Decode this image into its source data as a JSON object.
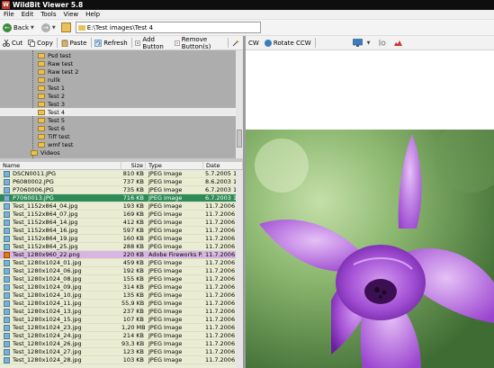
{
  "window": {
    "title": "WildBit Viewer 5.8",
    "app_icon": "W"
  },
  "menu": [
    "File",
    "Edit",
    "Tools",
    "View",
    "Help"
  ],
  "nav": {
    "back_label": "Back",
    "address": "E:\\Test images\\Test 4"
  },
  "toolbar": {
    "cut": "Cut",
    "copy": "Copy",
    "paste": "Paste",
    "refresh": "Refresh",
    "add_button": "Add Button",
    "remove_buttons": "Remove Button(s)"
  },
  "viewer_toolbar": {
    "rotate_cw_partial": "CW",
    "rotate_ccw": "Rotate CCW"
  },
  "tree": {
    "items": [
      {
        "label": "Psd test"
      },
      {
        "label": "Raw test"
      },
      {
        "label": "Raw test 2"
      },
      {
        "label": "rullk"
      },
      {
        "label": "Test 1"
      },
      {
        "label": "Test 2"
      },
      {
        "label": "Test 3"
      },
      {
        "label": "Test 4",
        "selected": true
      },
      {
        "label": "Test 5"
      },
      {
        "label": "Test 6"
      },
      {
        "label": "Tiff test"
      },
      {
        "label": "wmf test"
      },
      {
        "label": "Videos"
      }
    ]
  },
  "list": {
    "columns": [
      "Name",
      "Size",
      "Type",
      "Date modified"
    ],
    "rows": [
      {
        "name": "DSCN0011.JPG",
        "size": "810 KB",
        "type": "JPEG Image",
        "date": "5.7.2005 17:1"
      },
      {
        "name": "P6080002.JPG",
        "size": "737 KB",
        "type": "JPEG Image",
        "date": "8.6.2003 14:5"
      },
      {
        "name": "P7060006.JPG",
        "size": "735 KB",
        "type": "JPEG Image",
        "date": "6.7.2003 14:5"
      },
      {
        "name": "P7060013.JPG",
        "size": "716 KB",
        "type": "JPEG Image",
        "date": "6.7.2003 14:5",
        "selected": true
      },
      {
        "name": "Test_1152x864_04.jpg",
        "size": "193 KB",
        "type": "JPEG Image",
        "date": "11.7.2006 20:"
      },
      {
        "name": "Test_1152x864_07.jpg",
        "size": "169 KB",
        "type": "JPEG Image",
        "date": "11.7.2006 20:"
      },
      {
        "name": "Test_1152x864_14.jpg",
        "size": "412 KB",
        "type": "JPEG Image",
        "date": "11.7.2006 20:"
      },
      {
        "name": "Test_1152x864_16.jpg",
        "size": "597 KB",
        "type": "JPEG Image",
        "date": "11.7.2006 20:"
      },
      {
        "name": "Test_1152x864_19.jpg",
        "size": "160 KB",
        "type": "JPEG Image",
        "date": "11.7.2006 20:"
      },
      {
        "name": "Test_1152x864_25.jpg",
        "size": "288 KB",
        "type": "JPEG Image",
        "date": "11.7.2006 20:"
      },
      {
        "name": "Test_1280x960_22.png",
        "size": "220 KB",
        "type": "Adobe Fireworks P...",
        "date": "11.7.2006 20:",
        "highlight": true
      },
      {
        "name": "Test_1280x1024_01.jpg",
        "size": "459 KB",
        "type": "JPEG Image",
        "date": "11.7.2006 20:"
      },
      {
        "name": "Test_1280x1024_06.jpg",
        "size": "192 KB",
        "type": "JPEG Image",
        "date": "11.7.2006 20:"
      },
      {
        "name": "Test_1280x1024_08.jpg",
        "size": "155 KB",
        "type": "JPEG Image",
        "date": "11.7.2006 20:"
      },
      {
        "name": "Test_1280x1024_09.jpg",
        "size": "314 KB",
        "type": "JPEG Image",
        "date": "11.7.2006 20:"
      },
      {
        "name": "Test_1280x1024_10.jpg",
        "size": "135 KB",
        "type": "JPEG Image",
        "date": "11.7.2006 20:"
      },
      {
        "name": "Test_1280x1024_11.jpg",
        "size": "55,9 KB",
        "type": "JPEG Image",
        "date": "11.7.2006 20:"
      },
      {
        "name": "Test_1280x1024_13.jpg",
        "size": "237 KB",
        "type": "JPEG Image",
        "date": "11.7.2006 20:"
      },
      {
        "name": "Test_1280x1024_15.jpg",
        "size": "107 KB",
        "type": "JPEG Image",
        "date": "11.7.2006 20:"
      },
      {
        "name": "Test_1280x1024_23.jpg",
        "size": "1,20 MB",
        "type": "JPEG Image",
        "date": "11.7.2006 20:"
      },
      {
        "name": "Test_1280x1024_24.jpg",
        "size": "214 KB",
        "type": "JPEG Image",
        "date": "11.7.2006 20:"
      },
      {
        "name": "Test_1280x1024_26.jpg",
        "size": "93,3 KB",
        "type": "JPEG Image",
        "date": "11.7.2006 20:"
      },
      {
        "name": "Test_1280x1024_27.jpg",
        "size": "123 KB",
        "type": "JPEG Image",
        "date": "11.7.2006 20:"
      },
      {
        "name": "Test_1280x1024_28.jpg",
        "size": "103 KB",
        "type": "JPEG Image",
        "date": "11.7.2006 20:"
      }
    ]
  },
  "colors": {
    "selected_row": "#2e8b57",
    "highlight_row": "#d8b6e4",
    "list_bg": "#eaedd3"
  }
}
